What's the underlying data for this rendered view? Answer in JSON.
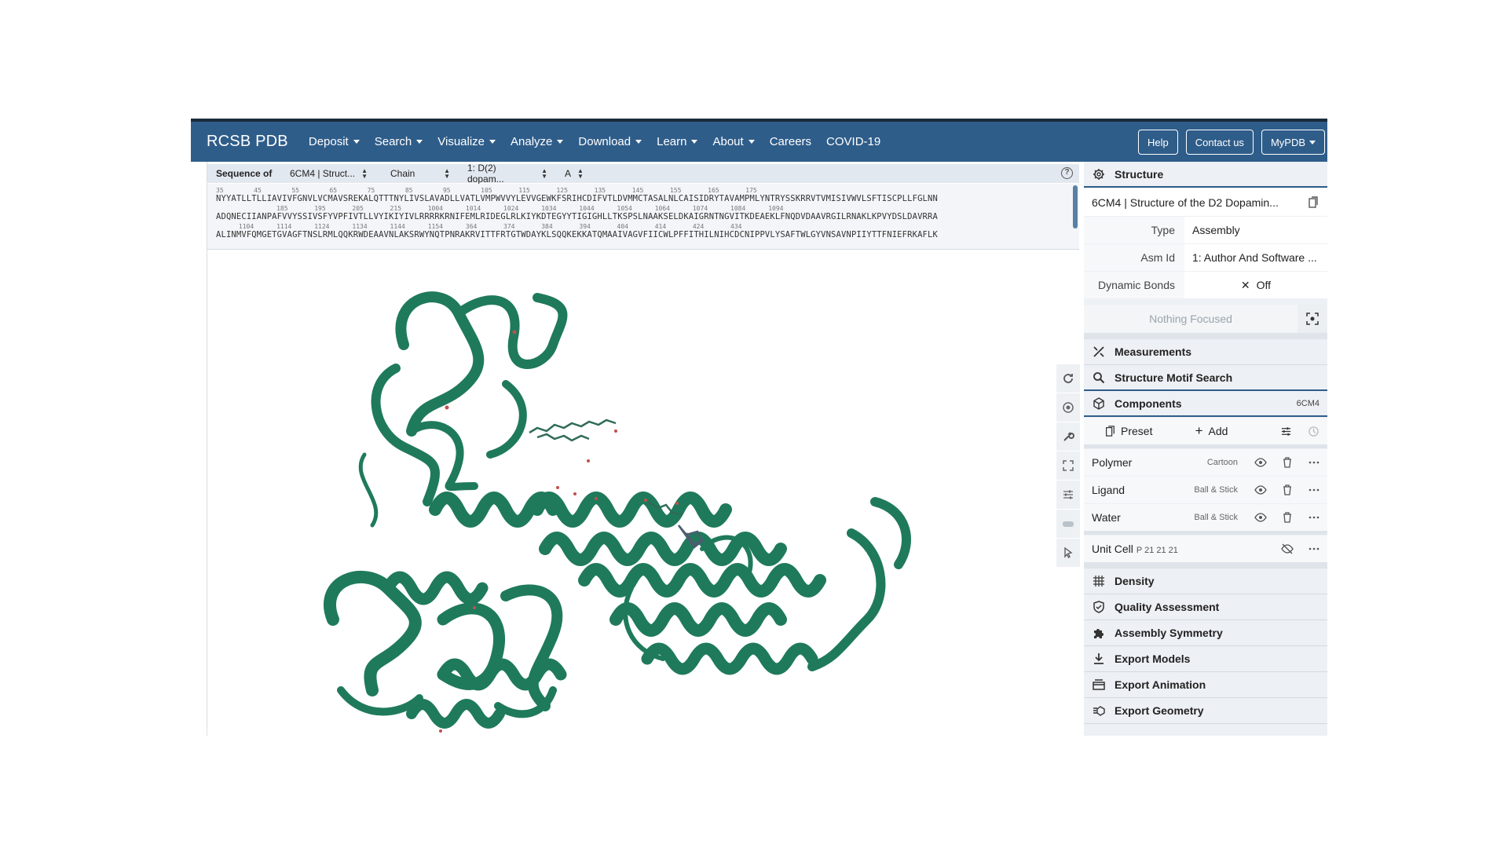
{
  "navbar": {
    "brand": "RCSB PDB",
    "items": [
      "Deposit",
      "Search",
      "Visualize",
      "Analyze",
      "Download",
      "Learn",
      "About",
      "Careers",
      "COVID-19"
    ],
    "buttons": {
      "help": "Help",
      "contact": "Contact us",
      "mypdb": "MyPDB"
    }
  },
  "sequence": {
    "label": "Sequence of",
    "entity_select": "6CM4 | Struct...",
    "mode_select": "Chain",
    "chain_select": "1: D(2) dopam...",
    "asym_select": "A",
    "lines": [
      {
        "nums": "35        45        55        65        75        85        95        105       115       125       135       145       155       165       175",
        "seq": "NYYATLLTLLIAVIVFGNVLVCMAVSREKALQTTTNYLIVSLAVADLLVATLVMPWVVYLEVVGEWKFSRIHCDIFVTLDVMMCTASALNLCAISIDRYTAVAMPMLYNTRYSSKRRVTVMISIVWVLSFTISCPLLFGLNN"
      },
      {
        "nums": "                185       195       205       215       1004      1014      1024      1034      1044      1054      1064      1074      1084      1094",
        "seq": "ADQNECIIANPAFVVYSSIVSFYVPFIVTLLVYIKIYIVLRRRRKRNIFEMLRIDEGLRLKIYKDTEGYYTIGIGHLLTKSPSLNAAKSELDKAIGRNTNGVITKDEAEKLFNQDVDAAVRGILRNAKLKPVYDSLDAVRRA"
      },
      {
        "nums": "      1104      1114      1124      1134      1144      1154      364       374       384       394       404       414       424       434",
        "seq": "ALINMVFQMGETGVAGFTNSLRMLQQKRWDEAAVNLAKSRWYNQTPNRAKRVITTFRTGTWDAYKLSQQKEKKATQMAAIVAGVFIICWLPFFITHILNIHCDCNIPPVLYSAFTWLGYVNSAVNPIIYTTFNIEFRKAFLK"
      }
    ]
  },
  "panel": {
    "structure": {
      "header": "Structure",
      "title": "6CM4 | Structure of the D2 Dopamin...",
      "rows": [
        {
          "key": "Type",
          "value": "Assembly"
        },
        {
          "key": "Asm Id",
          "value": "1: Author And Software ..."
        },
        {
          "key": "Dynamic Bonds",
          "value": "Off"
        }
      ],
      "focus": "Nothing Focused"
    },
    "measurements": "Measurements",
    "motif": "Structure Motif Search",
    "components": {
      "header": "Components",
      "tag": "6CM4",
      "preset": "Preset",
      "add": "Add",
      "items": [
        {
          "name": "Polymer",
          "rep": "Cartoon"
        },
        {
          "name": "Ligand",
          "rep": "Ball & Stick"
        },
        {
          "name": "Water",
          "rep": "Ball & Stick"
        }
      ],
      "unit_cell": "Unit Cell",
      "unit_cell_group": "P 21 21 21"
    },
    "sections": [
      "Density",
      "Quality Assessment",
      "Assembly Symmetry",
      "Export Models",
      "Export Animation",
      "Export Geometry"
    ]
  },
  "colors": {
    "nav": "#2f5d8a",
    "protein": "#1f7a5c",
    "panel": "#edf0f4"
  },
  "icons": [
    "refresh-icon",
    "spin-icon",
    "wrench-icon",
    "expand-icon",
    "sliders-icon",
    "vr-icon",
    "cursor-icon"
  ]
}
